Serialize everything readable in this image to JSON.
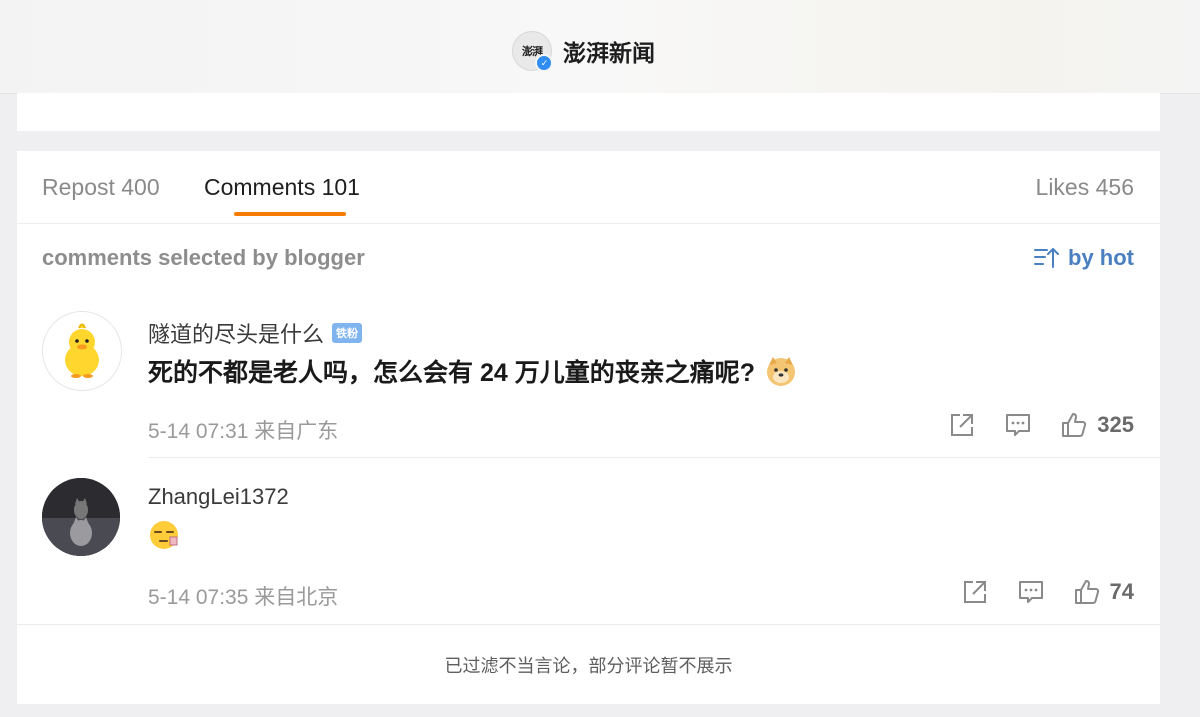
{
  "header": {
    "account_avatar_text": "澎湃",
    "account_name": "澎湃新闻"
  },
  "tabs": {
    "repost": "Repost 400",
    "comments": "Comments 101",
    "likes": "Likes 456"
  },
  "section": {
    "title": "comments selected by blogger",
    "sort_label": "by hot"
  },
  "comments": [
    {
      "user": "隧道的尽头是什么",
      "badge": "铁粉",
      "text": "死的不都是老人吗，怎么会有 24 万儿童的丧亲之痛呢?",
      "emoji": "doge-emoji",
      "time": "5-14 07:31 来自广东",
      "likes": "325"
    },
    {
      "user": "ZhangLei1372",
      "text": "",
      "emoji": "sleepy-face-emoji",
      "time": "5-14 07:35 来自北京",
      "likes": "74"
    }
  ],
  "footer": {
    "note": "已过滤不当言论，部分评论暂不展示"
  },
  "colors": {
    "accent_tab": "#f57c00",
    "sort_link": "#4a7fc0",
    "badge": "#7fb4ef"
  }
}
